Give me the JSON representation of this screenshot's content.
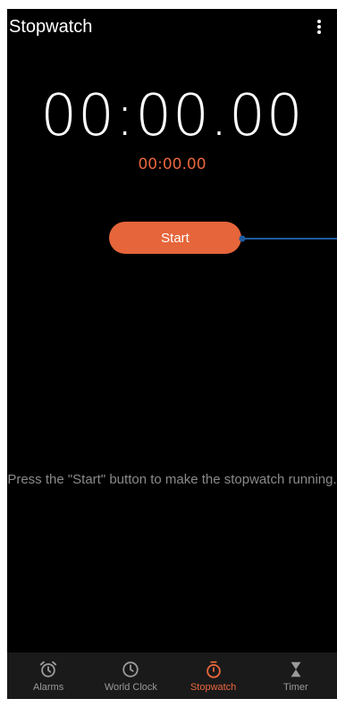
{
  "app": {
    "title": "Stopwatch",
    "menu_icon": "more-vert-icon"
  },
  "stopwatch": {
    "main_time": "00:00.00",
    "lap_time": "00:00.00",
    "start_label": "Start",
    "hint": "Press the \"Start\" button to make the stopwatch running."
  },
  "nav": {
    "items": [
      {
        "label": "Alarms",
        "icon": "alarm-icon",
        "active": false
      },
      {
        "label": "World Clock",
        "icon": "clock-icon",
        "active": false
      },
      {
        "label": "Stopwatch",
        "icon": "stopwatch-icon",
        "active": true
      },
      {
        "label": "Timer",
        "icon": "hourglass-icon",
        "active": false
      }
    ]
  },
  "colors": {
    "background": "#000000",
    "accent": "#e6653a",
    "nav_background": "#1a1a1a",
    "inactive": "#9a9a9a",
    "connector": "#1e5aa0"
  }
}
